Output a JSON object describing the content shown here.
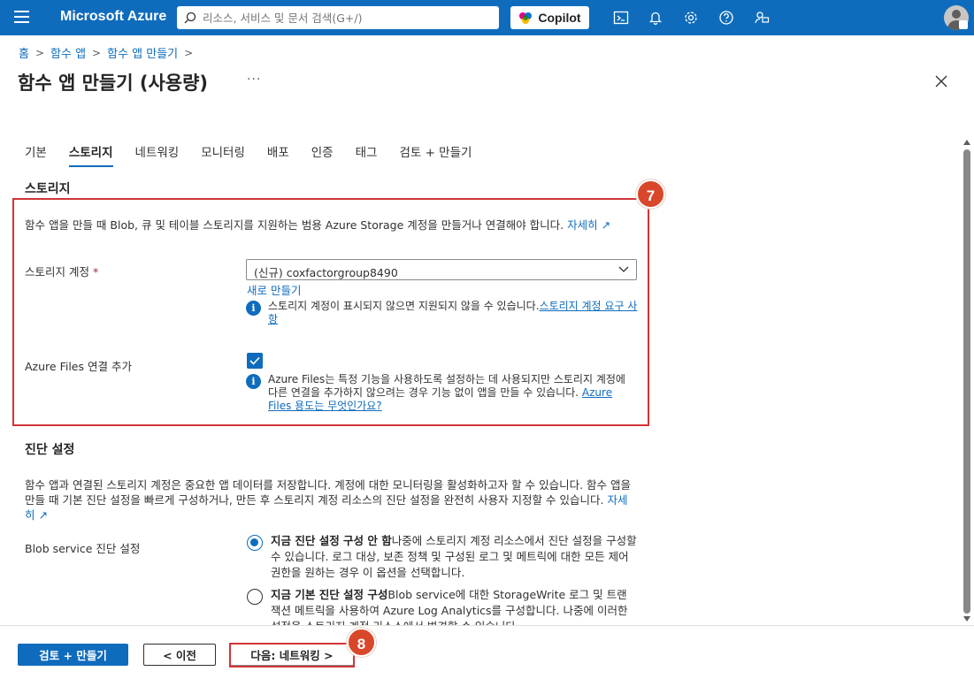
{
  "topbar": {
    "brand": "Microsoft Azure",
    "search_placeholder": "리소스, 서비스 및 문서 검색(G+/)",
    "copilot_label": "Copilot",
    "icons": [
      "cloud-shell-icon",
      "bell-icon",
      "gear-icon",
      "help-icon",
      "feedback-icon"
    ]
  },
  "breadcrumb": [
    "홈",
    "함수 앱",
    "함수 앱 만들기"
  ],
  "page": {
    "title": "함수 앱 만들기 (사용량)",
    "more": "···"
  },
  "tabs": [
    "기본",
    "스토리지",
    "네트워킹",
    "모니터링",
    "배포",
    "인증",
    "태그",
    "검토 + 만들기"
  ],
  "active_tab": "스토리지",
  "storage": {
    "section_title": "스토리지",
    "description": "함수 앱을 만들 때 Blob, 큐 및 테이블 스토리지를 지원하는 범용 Azure Storage 계정을 만들거나 연결해야 합니다.",
    "learn_more": "자세히",
    "account_label": "스토리지 계정",
    "required_mark": "*",
    "account_value": "(신규) coxfactorgroup8490",
    "create_new": "새로 만들기",
    "account_info": "스토리지 계정이 표시되지 않으면 지원되지 않을 수 있습니다.",
    "account_info_link": "스토리지 계정 요구 사항",
    "files_label": "Azure Files 연결 추가",
    "files_info": "Azure Files는 특정 기능을 사용하도록 설정하는 데 사용되지만 스토리지 계정에 다른 연결을 추가하지 않으려는 경우 기능 없이 앱을 만들 수 있습니다.",
    "files_info_link": "Azure Files 용도는 무엇인가요?"
  },
  "diagnostics": {
    "section_title": "진단 설정",
    "description": "함수 앱과 연결된 스토리지 계정은 중요한 앱 데이터를 저장합니다. 계정에 대한 모니터링을 활성화하고자 할 수 있습니다. 함수 앱을 만들 때 기본 진단 설정을 빠르게 구성하거나, 만든 후 스토리지 계정 리소스의 진단 설정을 완전히 사용자 지정할 수 있습니다.",
    "learn_more": "자세히",
    "blob_label": "Blob service 진단 설정",
    "option1_bold": "지금 진단 설정 구성 안 함",
    "option1_text": "나중에 스토리지 계정 리소스에서 진단 설정을 구성할 수 있습니다. 로그 대상, 보존 정책 및 구성된 로그 및 메트릭에 대한 모든 제어 권한을 원하는 경우 이 옵션을 선택합니다.",
    "option2_bold": "지금 기본 진단 설정 구성",
    "option2_text": "Blob service에 대한 StorageWrite 로그 및 트랜잭션 메트릭을 사용하여 Azure Log Analytics를 구성합니다. 나중에 이러한 설정을 스토리지 계정 리소스에서 변경할 수 있습니다."
  },
  "callouts": {
    "storage_box": "7",
    "next_button": "8"
  },
  "footer": {
    "review_create": "검토 + 만들기",
    "previous": "< 이전",
    "next": "다음: 네트워킹 >"
  },
  "colors": {
    "accent": "#0f6cbd",
    "highlight": "#d13438",
    "callout": "#d9472b"
  }
}
